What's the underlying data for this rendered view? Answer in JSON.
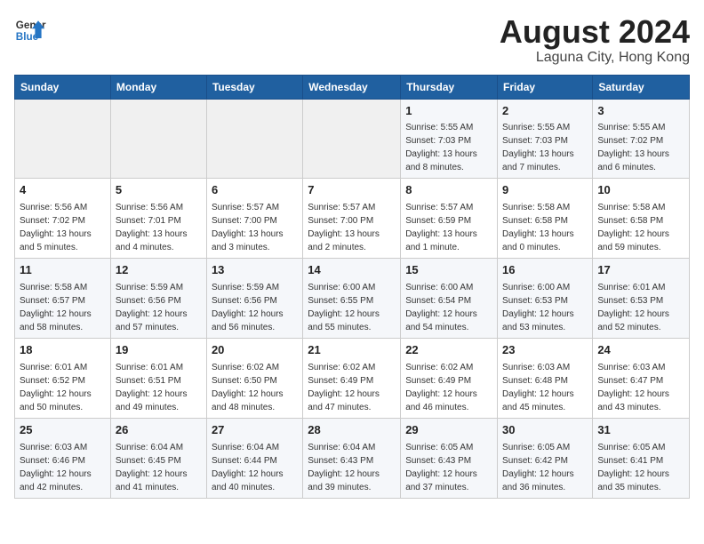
{
  "header": {
    "logo_line1": "General",
    "logo_line2": "Blue",
    "month_year": "August 2024",
    "location": "Laguna City, Hong Kong"
  },
  "weekdays": [
    "Sunday",
    "Monday",
    "Tuesday",
    "Wednesday",
    "Thursday",
    "Friday",
    "Saturday"
  ],
  "weeks": [
    [
      {
        "day": "",
        "info": ""
      },
      {
        "day": "",
        "info": ""
      },
      {
        "day": "",
        "info": ""
      },
      {
        "day": "",
        "info": ""
      },
      {
        "day": "1",
        "info": "Sunrise: 5:55 AM\nSunset: 7:03 PM\nDaylight: 13 hours\nand 8 minutes."
      },
      {
        "day": "2",
        "info": "Sunrise: 5:55 AM\nSunset: 7:03 PM\nDaylight: 13 hours\nand 7 minutes."
      },
      {
        "day": "3",
        "info": "Sunrise: 5:55 AM\nSunset: 7:02 PM\nDaylight: 13 hours\nand 6 minutes."
      }
    ],
    [
      {
        "day": "4",
        "info": "Sunrise: 5:56 AM\nSunset: 7:02 PM\nDaylight: 13 hours\nand 5 minutes."
      },
      {
        "day": "5",
        "info": "Sunrise: 5:56 AM\nSunset: 7:01 PM\nDaylight: 13 hours\nand 4 minutes."
      },
      {
        "day": "6",
        "info": "Sunrise: 5:57 AM\nSunset: 7:00 PM\nDaylight: 13 hours\nand 3 minutes."
      },
      {
        "day": "7",
        "info": "Sunrise: 5:57 AM\nSunset: 7:00 PM\nDaylight: 13 hours\nand 2 minutes."
      },
      {
        "day": "8",
        "info": "Sunrise: 5:57 AM\nSunset: 6:59 PM\nDaylight: 13 hours\nand 1 minute."
      },
      {
        "day": "9",
        "info": "Sunrise: 5:58 AM\nSunset: 6:58 PM\nDaylight: 13 hours\nand 0 minutes."
      },
      {
        "day": "10",
        "info": "Sunrise: 5:58 AM\nSunset: 6:58 PM\nDaylight: 12 hours\nand 59 minutes."
      }
    ],
    [
      {
        "day": "11",
        "info": "Sunrise: 5:58 AM\nSunset: 6:57 PM\nDaylight: 12 hours\nand 58 minutes."
      },
      {
        "day": "12",
        "info": "Sunrise: 5:59 AM\nSunset: 6:56 PM\nDaylight: 12 hours\nand 57 minutes."
      },
      {
        "day": "13",
        "info": "Sunrise: 5:59 AM\nSunset: 6:56 PM\nDaylight: 12 hours\nand 56 minutes."
      },
      {
        "day": "14",
        "info": "Sunrise: 6:00 AM\nSunset: 6:55 PM\nDaylight: 12 hours\nand 55 minutes."
      },
      {
        "day": "15",
        "info": "Sunrise: 6:00 AM\nSunset: 6:54 PM\nDaylight: 12 hours\nand 54 minutes."
      },
      {
        "day": "16",
        "info": "Sunrise: 6:00 AM\nSunset: 6:53 PM\nDaylight: 12 hours\nand 53 minutes."
      },
      {
        "day": "17",
        "info": "Sunrise: 6:01 AM\nSunset: 6:53 PM\nDaylight: 12 hours\nand 52 minutes."
      }
    ],
    [
      {
        "day": "18",
        "info": "Sunrise: 6:01 AM\nSunset: 6:52 PM\nDaylight: 12 hours\nand 50 minutes."
      },
      {
        "day": "19",
        "info": "Sunrise: 6:01 AM\nSunset: 6:51 PM\nDaylight: 12 hours\nand 49 minutes."
      },
      {
        "day": "20",
        "info": "Sunrise: 6:02 AM\nSunset: 6:50 PM\nDaylight: 12 hours\nand 48 minutes."
      },
      {
        "day": "21",
        "info": "Sunrise: 6:02 AM\nSunset: 6:49 PM\nDaylight: 12 hours\nand 47 minutes."
      },
      {
        "day": "22",
        "info": "Sunrise: 6:02 AM\nSunset: 6:49 PM\nDaylight: 12 hours\nand 46 minutes."
      },
      {
        "day": "23",
        "info": "Sunrise: 6:03 AM\nSunset: 6:48 PM\nDaylight: 12 hours\nand 45 minutes."
      },
      {
        "day": "24",
        "info": "Sunrise: 6:03 AM\nSunset: 6:47 PM\nDaylight: 12 hours\nand 43 minutes."
      }
    ],
    [
      {
        "day": "25",
        "info": "Sunrise: 6:03 AM\nSunset: 6:46 PM\nDaylight: 12 hours\nand 42 minutes."
      },
      {
        "day": "26",
        "info": "Sunrise: 6:04 AM\nSunset: 6:45 PM\nDaylight: 12 hours\nand 41 minutes."
      },
      {
        "day": "27",
        "info": "Sunrise: 6:04 AM\nSunset: 6:44 PM\nDaylight: 12 hours\nand 40 minutes."
      },
      {
        "day": "28",
        "info": "Sunrise: 6:04 AM\nSunset: 6:43 PM\nDaylight: 12 hours\nand 39 minutes."
      },
      {
        "day": "29",
        "info": "Sunrise: 6:05 AM\nSunset: 6:43 PM\nDaylight: 12 hours\nand 37 minutes."
      },
      {
        "day": "30",
        "info": "Sunrise: 6:05 AM\nSunset: 6:42 PM\nDaylight: 12 hours\nand 36 minutes."
      },
      {
        "day": "31",
        "info": "Sunrise: 6:05 AM\nSunset: 6:41 PM\nDaylight: 12 hours\nand 35 minutes."
      }
    ]
  ]
}
